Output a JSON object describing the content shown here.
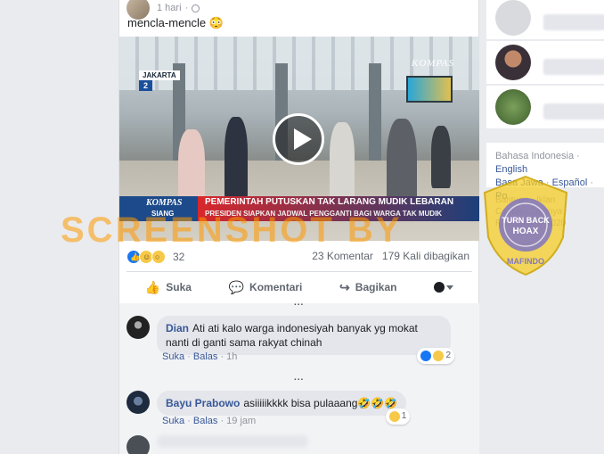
{
  "post": {
    "time": "1 hari",
    "text": "mencla-mencle 😳",
    "video": {
      "sign_city": "JAKARTA",
      "sign_platform": "2",
      "channel_logo": "KOMPAS",
      "lower_logo_top": "KOMPAS",
      "lower_logo_bottom": "SIANG",
      "headline": "PEMERINTAH PUTUSKAN TAK LARANG MUDIK LEBARAN",
      "subheadline": "PRESIDEN SIAPKAN JADWAL PENGGANTI BAGI WARGA TAK MUDIK"
    },
    "reaction_count": "32",
    "comments_count": "23 Komentar",
    "shares_count": "179 Kali dibagikan",
    "actions": {
      "like": "Suka",
      "comment": "Komentari",
      "share": "Bagikan"
    }
  },
  "comments": [
    {
      "name": "Dian",
      "text": "Ati ati kalo warga indonesiyah banyak yg mokat nanti di ganti sama rakyat chinah",
      "like": "Suka",
      "reply": "Balas",
      "time": "1h",
      "reactions": "2"
    },
    {
      "name": "Bayu Prabowo",
      "text": "asiiiiikkkk bisa pulaaang🤣🤣🤣",
      "like": "Suka",
      "reply": "Balas",
      "time": "19 jam",
      "reactions": "1"
    }
  ],
  "more_dots": "...",
  "sidebar": {
    "languages_line1": "Bahasa Indonesia · ",
    "lang_english": "English",
    "lang_jawa": "Basa Jawa",
    "lang_espanol": "Español",
    "lang_po": "Po",
    "footer_line1": "Bantuan · Iklan",
    "footer_line2": "Cookie · Lainnya",
    "footer_line3": "Facebook © 2020"
  },
  "watermark": {
    "text": "SCREENSHOT BY",
    "badge_top": "MASYARAKAT ANTI FITNAH INDONESIA",
    "badge_mid": "TURN BACK HOAX",
    "badge_bottom": "MAFINDO"
  },
  "colors": {
    "link": "#385898",
    "accent": "#1877f2",
    "watermark": "#ff9900"
  }
}
